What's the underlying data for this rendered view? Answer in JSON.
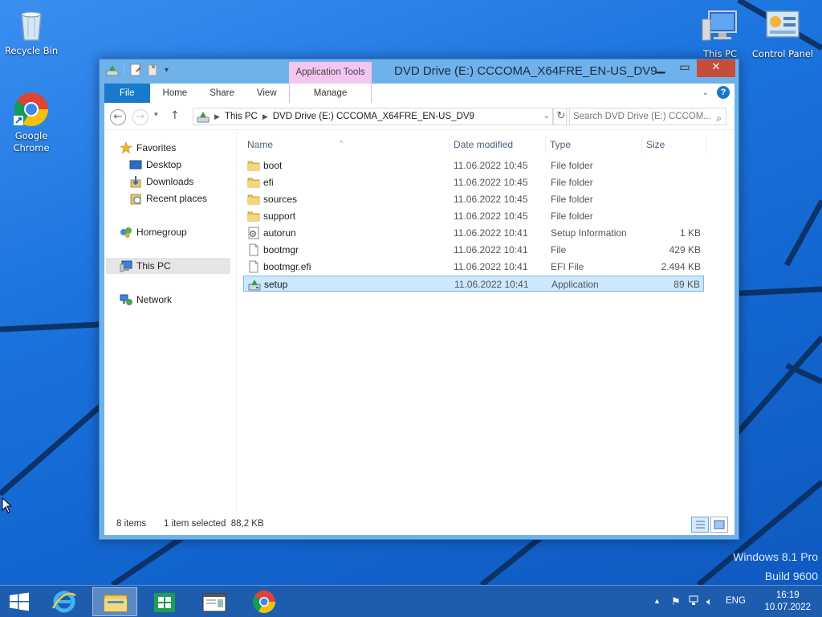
{
  "desktop": {
    "icons": {
      "recycle_bin": "Recycle Bin",
      "chrome": "Google Chrome",
      "this_pc": "This PC",
      "control_panel": "Control Panel"
    },
    "watermark": {
      "line1": "Windows 8.1 Pro",
      "line2": "Build 9600"
    }
  },
  "window": {
    "title": "DVD Drive (E:) CCCOMA_X64FRE_EN-US_DV9",
    "contextual_tab_group": "Application Tools",
    "ribbon_tabs": {
      "file": "File",
      "home": "Home",
      "share": "Share",
      "view": "View",
      "manage": "Manage"
    },
    "address": {
      "part1": "This PC",
      "part2": "DVD Drive (E:) CCCOMA_X64FRE_EN-US_DV9"
    },
    "search_placeholder": "Search DVD Drive (E:) CCCOM...",
    "nav": {
      "favorites": "Favorites",
      "desktop": "Desktop",
      "downloads": "Downloads",
      "recent_places": "Recent places",
      "homegroup": "Homegroup",
      "this_pc": "This PC",
      "network": "Network"
    },
    "columns": {
      "name": "Name",
      "date": "Date modified",
      "type": "Type",
      "size": "Size"
    },
    "files": [
      {
        "name": "boot",
        "date": "11.06.2022 10:45",
        "type": "File folder",
        "size": "",
        "icon": "folder-icon"
      },
      {
        "name": "efi",
        "date": "11.06.2022 10:45",
        "type": "File folder",
        "size": "",
        "icon": "folder-icon"
      },
      {
        "name": "sources",
        "date": "11.06.2022 10:45",
        "type": "File folder",
        "size": "",
        "icon": "folder-icon"
      },
      {
        "name": "support",
        "date": "11.06.2022 10:45",
        "type": "File folder",
        "size": "",
        "icon": "folder-icon"
      },
      {
        "name": "autorun",
        "date": "11.06.2022 10:41",
        "type": "Setup Information",
        "size": "1 KB",
        "icon": "setup-info-icon"
      },
      {
        "name": "bootmgr",
        "date": "11.06.2022 10:41",
        "type": "File",
        "size": "429 KB",
        "icon": "file-icon"
      },
      {
        "name": "bootmgr.efi",
        "date": "11.06.2022 10:41",
        "type": "EFI File",
        "size": "2.494 KB",
        "icon": "file-icon"
      },
      {
        "name": "setup",
        "date": "11.06.2022 10:41",
        "type": "Application",
        "size": "89 KB",
        "icon": "setup-app-icon"
      }
    ],
    "status": {
      "count": "8 items",
      "selection": "1 item selected  88,2 KB"
    }
  },
  "taskbar": {
    "language": "ENG",
    "time": "16:19",
    "date": "10.07.2022"
  },
  "colors": {
    "accent": "#1979ca",
    "app_tools": "#f3c6f0",
    "selection": "#cce8ff",
    "close": "#c74c3c"
  }
}
